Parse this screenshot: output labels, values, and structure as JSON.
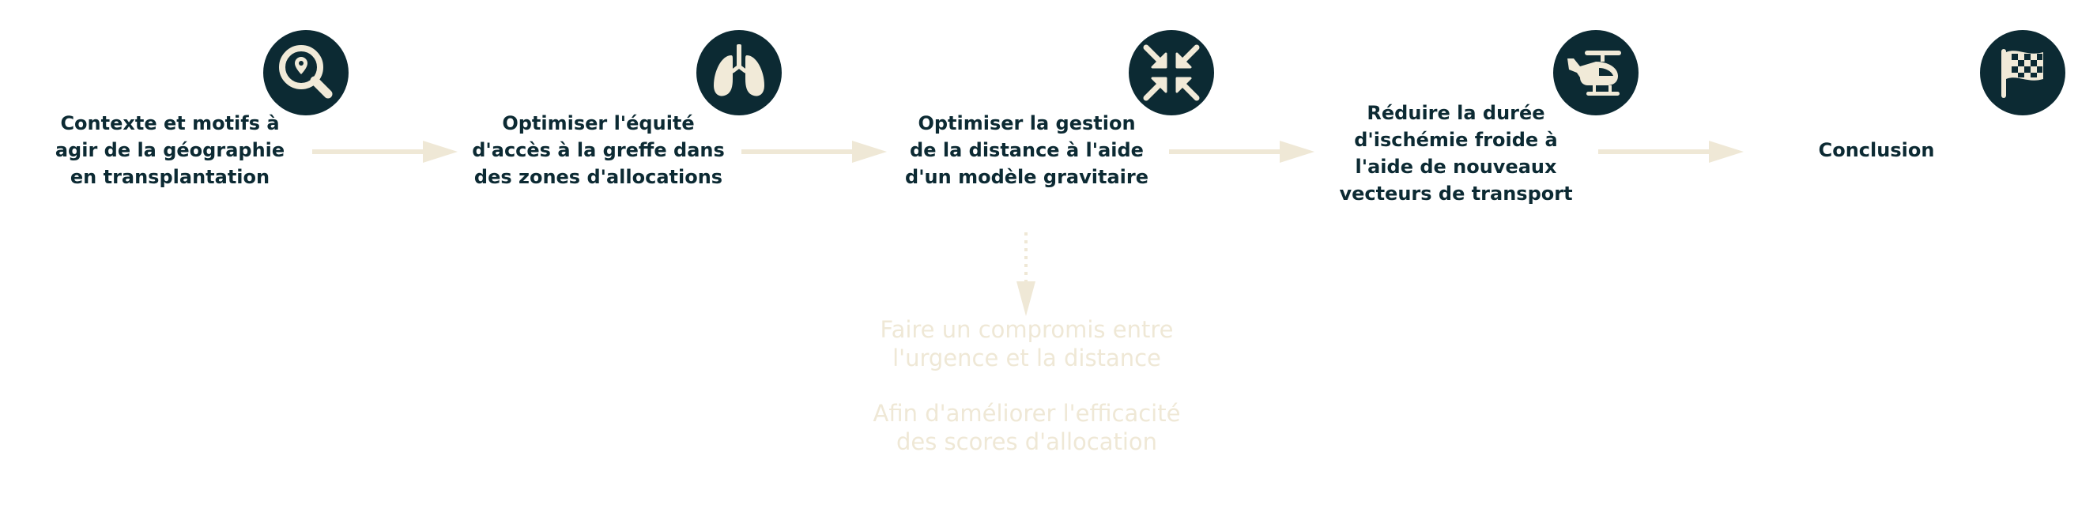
{
  "colors": {
    "icon_bg": "#0c2a33",
    "icon_fg": "#f1ead8",
    "text": "#0c2a33",
    "arrow": "#efe8d6",
    "note": "#efe8d6"
  },
  "steps": [
    {
      "icon": "search-location-icon",
      "label": "Contexte et motifs à\nagir de la géographie\nen transplantation"
    },
    {
      "icon": "lungs-icon",
      "label": "Optimiser l'équité\nd'accès à la greffe dans\ndes zones d'allocations"
    },
    {
      "icon": "compress-arrows-icon",
      "label": "Optimiser la gestion\nde la distance à l'aide\nd'un modèle gravitaire"
    },
    {
      "icon": "helicopter-icon",
      "label": "Réduire la durée\nd'ischémie froide à\nl'aide de nouveaux\nvecteurs de transport"
    },
    {
      "icon": "checkered-flag-icon",
      "label": "Conclusion"
    }
  ],
  "note": {
    "line1": "Faire un compromis entre\nl'urgence et la distance",
    "line2": "Afin d'améliorer l'efficacité\ndes scores d'allocation"
  }
}
